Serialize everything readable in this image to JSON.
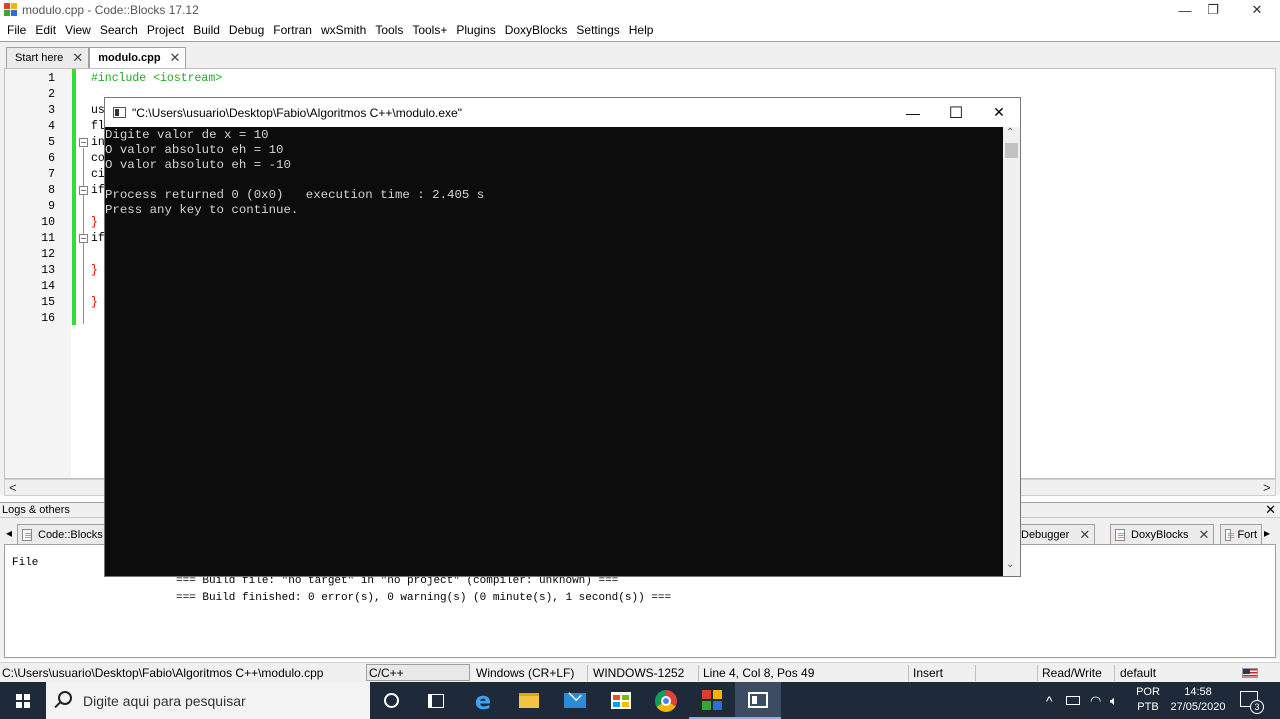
{
  "window": {
    "title": "modulo.cpp - Code::Blocks 17.12",
    "controls": {
      "minimize": "—",
      "restore": "❐",
      "close": "✕"
    }
  },
  "menu": [
    "File",
    "Edit",
    "View",
    "Search",
    "Project",
    "Build",
    "Debug",
    "Fortran",
    "wxSmith",
    "Tools",
    "Tools+",
    "Plugins",
    "DoxyBlocks",
    "Settings",
    "Help"
  ],
  "editor": {
    "tabs": [
      {
        "label": "Start here",
        "close": "✕",
        "active": false
      },
      {
        "label": "modulo.cpp",
        "close": "✕",
        "active": true
      }
    ],
    "line_numbers": [
      "1",
      "2",
      "3",
      "4",
      "5",
      "6",
      "7",
      "8",
      "9",
      "10",
      "11",
      "12",
      "13",
      "14",
      "15",
      "16"
    ],
    "visible_code": {
      "l1": "#include <iostream>",
      "l3": "us",
      "l4": "fl",
      "l5": "in",
      "l6": "co",
      "l7": "ci",
      "l8": "if",
      "l10": "}",
      "l11": "if",
      "l13": "}",
      "l15": "}"
    },
    "scroll": {
      "left": "<",
      "right": ">"
    }
  },
  "console": {
    "title": "\"C:\\Users\\usuario\\Desktop\\Fabio\\Algoritmos C++\\modulo.exe\"",
    "controls": {
      "minimize": "—",
      "maximize": "☐",
      "close": "✕"
    },
    "lines": [
      "Digite valor de x = 10",
      "O valor absoluto eh = 10",
      "O valor absoluto eh = -10",
      "",
      "Process returned 0 (0x0)   execution time : 2.405 s",
      "Press any key to continue."
    ],
    "scroll": {
      "up": "⌃",
      "down": "⌄"
    }
  },
  "logs": {
    "header": "Logs & others",
    "close": "✕",
    "tabs": [
      {
        "label": "Code::Blocks"
      },
      {
        "label": "Debugger",
        "close": "✕"
      },
      {
        "label": "DoxyBlocks",
        "close": "✕"
      },
      {
        "label": "Fort",
        "close": ""
      }
    ],
    "tab_nav": {
      "left": "◂",
      "right": "▸"
    },
    "column_file": "File",
    "messages": [
      "=== Build file: \"no target\" in \"no project\" (compiler: unknown) ===",
      "=== Build finished: 0 error(s), 0 warning(s) (0 minute(s), 1 second(s)) ==="
    ]
  },
  "statusbar": {
    "path": "C:\\Users\\usuario\\Desktop\\Fabio\\Algoritmos C++\\modulo.cpp",
    "language": "C/C++",
    "line_endings": "Windows (CR+LF)",
    "encoding": "WINDOWS-1252",
    "position": "Line 4, Col 8, Pos 49",
    "mode": "Insert",
    "access": "Read/Write",
    "profile": "default"
  },
  "taskbar": {
    "search_placeholder": "Digite aqui para pesquisar",
    "language_line1": "POR",
    "language_line2": "PTB",
    "time": "14:58",
    "date": "27/05/2020",
    "notification_count": "3",
    "tray_chevron": "^",
    "colors": {
      "background": "#1e2a3a",
      "accent": "#76b9ed"
    }
  }
}
